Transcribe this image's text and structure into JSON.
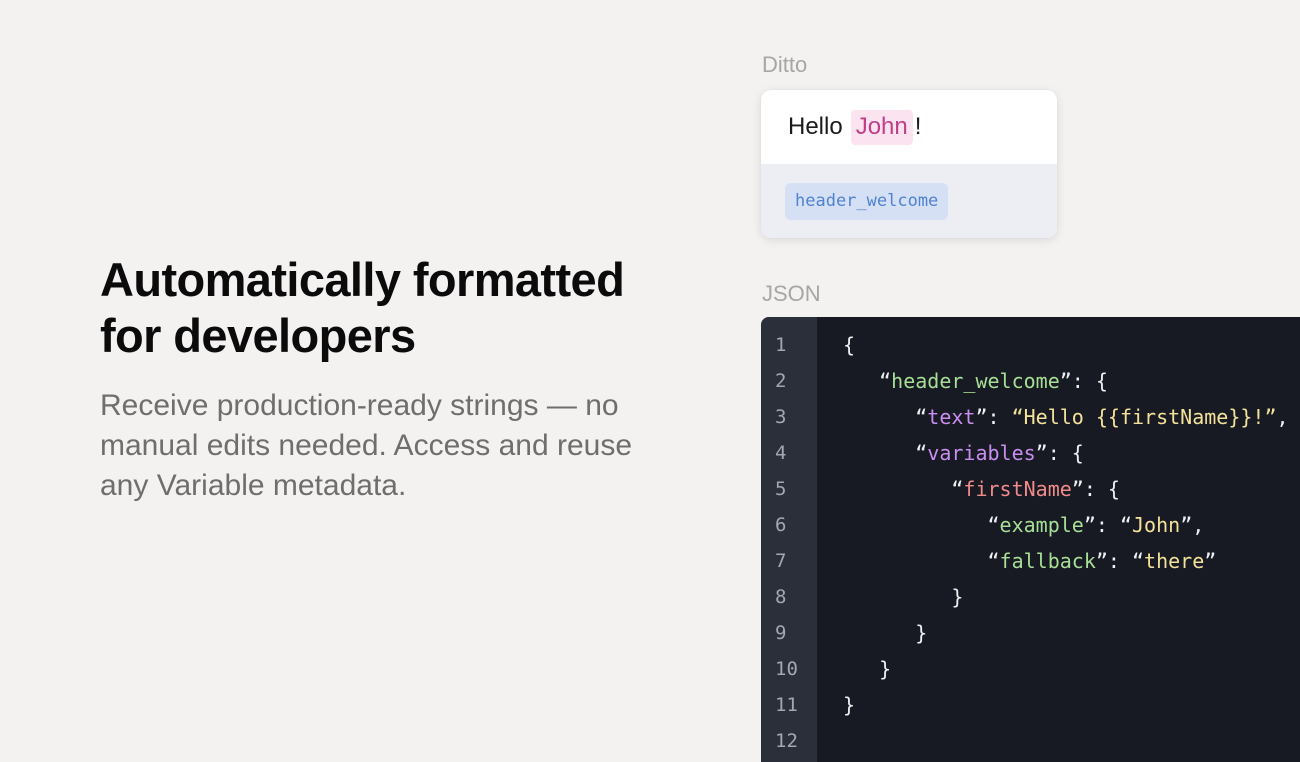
{
  "hero": {
    "title_line1": "Automatically formatted",
    "title_line2": "for developers",
    "body": "Receive production-ready strings — no manual edits needed. Access and reuse any Variable metadata."
  },
  "ditto": {
    "label": "Ditto",
    "greeting": "Hello",
    "variable_value": "John",
    "punctuation": "!",
    "key": "header_welcome"
  },
  "json_panel": {
    "label": "JSON",
    "line_numbers": [
      "1",
      "2",
      "3",
      "4",
      "5",
      "6",
      "7",
      "8",
      "9",
      "10",
      "11",
      "12"
    ],
    "tokens": {
      "open_brace": "{",
      "close_brace": "}",
      "key_header": "header_welcome",
      "key_text": "text",
      "value_text": "Hello {{firstName}}!",
      "key_variables": "variables",
      "key_firstname": "firstName",
      "key_example": "example",
      "value_example": "John",
      "key_fallback": "fallback",
      "value_fallback": "there"
    }
  },
  "colors": {
    "background": "#f4f2f0",
    "variable_chip": "#fbe4ef",
    "variable_text": "#c23f88",
    "key_chip": "#d5e0f4",
    "key_text": "#4f82d0",
    "code_bg": "#171a22",
    "gutter_bg": "#2a2f3a"
  }
}
